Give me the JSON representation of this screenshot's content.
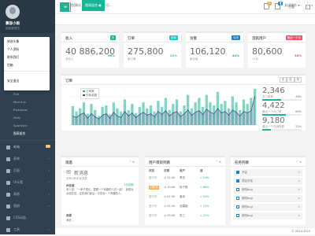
{
  "profile": {
    "name": "慕容小雨",
    "role": "超级管理员"
  },
  "dropdown": {
    "items": [
      "修改头像",
      "个人资料",
      "联系我们",
      "信箱",
      "安全退出"
    ]
  },
  "sublinks": [
    "Flot",
    "Morris.js",
    "Rickshaw",
    "Peity",
    "Sparkline",
    "图表组合"
  ],
  "nav": [
    {
      "label": "邮箱",
      "badge": "16"
    },
    {
      "label": "表单"
    },
    {
      "label": "页面"
    },
    {
      "label": "UI元素"
    },
    {
      "label": "表格"
    },
    {
      "label": "相册"
    },
    {
      "label": "CSS动画"
    },
    {
      "label": "工具"
    }
  ],
  "topbar": {
    "search_placeholder": "请输入您需要查找的内容...",
    "badge1": "4",
    "badge2": "8",
    "theme": "主题",
    "tab_ops": "关闭操作"
  },
  "tabs": {
    "home": "首页",
    "active": "图表组合"
  },
  "cards": [
    {
      "title": "收入",
      "badge": "月",
      "badge_color": "#1ab394",
      "value": "40 886,200",
      "pct": "98%",
      "sub": "总收入",
      "pct_color": "#1ab394"
    },
    {
      "title": "订单",
      "badge": "全年",
      "badge_color": "#23c6c8",
      "value": "275,800",
      "pct": "20%",
      "sub": "新订单",
      "pct_color": "#23c6c8"
    },
    {
      "title": "访客",
      "badge": "今天",
      "badge_color": "#1c84c6",
      "value": "106,120",
      "pct": "44%",
      "sub": "新访客",
      "pct_color": "#1ab394"
    },
    {
      "title": "活跃用户",
      "badge": "最近一个月",
      "badge_color": "#ed5565",
      "value": "80,600",
      "pct": "38%",
      "sub": "12月",
      "pct_color": "#ed5565"
    }
  ],
  "orders": {
    "title": "订单",
    "buttons": [
      "天",
      "月",
      "年"
    ],
    "legend": [
      "订单数",
      "付款金额"
    ],
    "stats": [
      {
        "value": "2,346",
        "label": "总订单数",
        "pct": "48%",
        "fill": 0.48
      },
      {
        "value": "4,422",
        "label": "最近一个月订单",
        "pct": "60%",
        "fill": 0.6
      },
      {
        "value": "9,180",
        "label": "最近一个月销售额",
        "pct": "22%",
        "fill": 0.22
      }
    ]
  },
  "chart_data": {
    "type": "bar",
    "title": "",
    "series": [
      {
        "name": "订单数",
        "values": [
          25,
          18,
          22,
          30,
          15,
          28,
          20,
          12,
          24,
          26,
          14,
          30,
          22,
          18,
          34,
          20,
          28,
          16,
          24,
          30,
          22,
          26,
          18,
          32,
          24,
          36,
          20,
          28,
          34,
          18,
          26,
          40,
          22,
          30,
          36,
          24,
          40,
          30,
          26,
          44,
          28,
          32,
          22,
          38,
          30,
          20,
          34,
          28,
          36,
          48
        ]
      },
      {
        "name": "付款金额",
        "values": [
          12,
          10,
          14,
          16,
          9,
          15,
          11,
          8,
          13,
          15,
          9,
          17,
          12,
          10,
          18,
          12,
          16,
          10,
          14,
          17,
          13,
          15,
          11,
          18,
          14,
          19,
          12,
          16,
          18,
          11,
          15,
          20,
          13,
          17,
          19,
          14,
          21,
          17,
          15,
          22,
          16,
          18,
          13,
          20,
          17,
          12,
          18,
          16,
          19,
          38
        ]
      }
    ]
  },
  "messages": {
    "title": "消息",
    "heading": "新消息",
    "sub": "您有2条未读消息",
    "entries": [
      {
        "name": "林依晨",
        "time": "1分钟前",
        "body": "有人说：\"一辈子很长，要跟一个有趣的人在一起\"，我想对女朋友说，这是我们最后一次告诉一个有趣的人。"
      },
      {
        "name": "谢娜",
        "time": "",
        "body": "我在..."
      }
    ]
  },
  "projects": {
    "title": "用户项目列表",
    "headers": [
      "状态",
      "日期",
      "用户",
      "值"
    ],
    "rows": [
      {
        "status": "进行中",
        "date": "11:20",
        "user": "青衣",
        "value": "24%"
      },
      {
        "status": "已取消",
        "date": "10:40",
        "user": "徐子默",
        "value": "66%"
      },
      {
        "status": "进行中",
        "date": "01:30",
        "user": "姜岚",
        "value": "54%"
      },
      {
        "status": "进行中",
        "date": "02:20",
        "user": "武媚娘",
        "value": "12%"
      },
      {
        "status": "进行中",
        "date": "09:40",
        "user": "张三",
        "value": "22%"
      }
    ]
  },
  "tasks": {
    "title": "任务列表",
    "items": [
      {
        "label": "开会",
        "checked": true
      },
      {
        "label": "项目开发",
        "checked": true
      },
      {
        "label": "修改bug",
        "checked": false
      },
      {
        "label": "修改bug",
        "checked": false
      },
      {
        "label": "修改bug",
        "checked": false
      },
      {
        "label": "修改bug",
        "checked": false
      }
    ]
  },
  "footer": "© 2014-2015"
}
